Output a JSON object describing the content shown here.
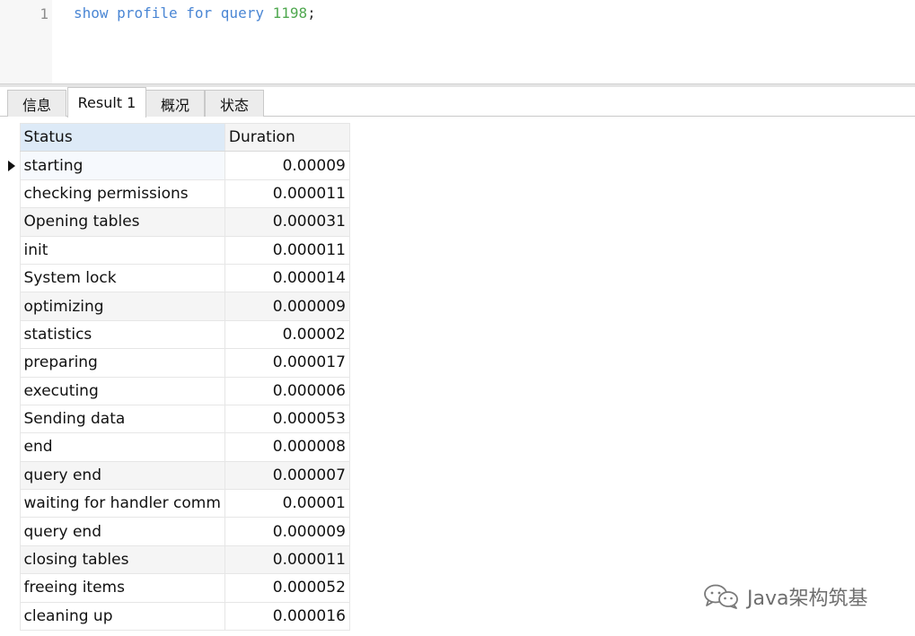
{
  "editor": {
    "line_number": "1",
    "tokens": {
      "kw1": "show",
      "kw2": "profile",
      "kw3": "for",
      "kw4": "query",
      "num": "1198",
      "end": ";"
    }
  },
  "tabs": [
    {
      "label": "信息"
    },
    {
      "label": "Result 1"
    },
    {
      "label": "概况"
    },
    {
      "label": "状态"
    }
  ],
  "grid": {
    "columns": {
      "status": "Status",
      "duration": "Duration"
    },
    "rows": [
      {
        "status": "starting",
        "duration": "0.00009"
      },
      {
        "status": "checking permissions",
        "duration": "0.000011"
      },
      {
        "status": "Opening tables",
        "duration": "0.000031"
      },
      {
        "status": "init",
        "duration": "0.000011"
      },
      {
        "status": "System lock",
        "duration": "0.000014"
      },
      {
        "status": "optimizing",
        "duration": "0.000009"
      },
      {
        "status": "statistics",
        "duration": "0.00002"
      },
      {
        "status": "preparing",
        "duration": "0.000017"
      },
      {
        "status": "executing",
        "duration": "0.000006"
      },
      {
        "status": "Sending data",
        "duration": "0.000053"
      },
      {
        "status": "end",
        "duration": "0.000008"
      },
      {
        "status": "query end",
        "duration": "0.000007"
      },
      {
        "status": "waiting for handler comm",
        "duration": "0.00001"
      },
      {
        "status": "query end",
        "duration": "0.000009"
      },
      {
        "status": "closing tables",
        "duration": "0.000011"
      },
      {
        "status": "freeing items",
        "duration": "0.000052"
      },
      {
        "status": "cleaning up",
        "duration": "0.000016"
      }
    ]
  },
  "watermark": {
    "text": "Java架构筑基",
    "icon": "wechat-icon"
  },
  "colors": {
    "keyword": "#4a86d4",
    "number": "#4fa84f",
    "header_selected": "#ddeaf7"
  }
}
